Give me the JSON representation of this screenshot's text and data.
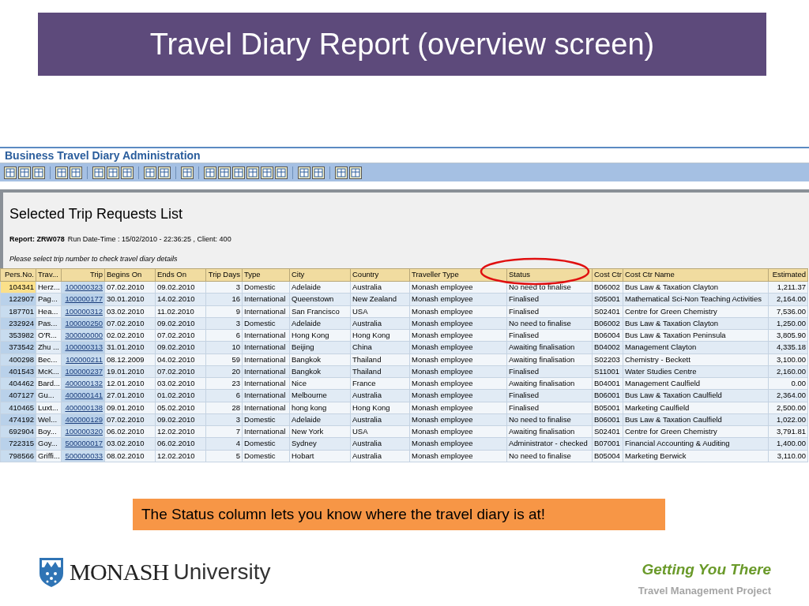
{
  "slide_title": "Travel Diary Report (overview screen)",
  "app": {
    "title": "Business Travel Diary Administration",
    "heading": "Selected Trip Requests List",
    "report_label": "Report: ZRW078",
    "report_info": "Run Date-Time : 15/02/2010 - 22:36:25 , Client: 400",
    "instruction": "Please select trip number to check travel diary details",
    "table": {
      "columns": [
        "Pers.No.",
        "Trav...",
        "Trip",
        "Begins On",
        "Ends On",
        "Trip Days",
        "Type",
        "City",
        "Country",
        "Traveller Type",
        "Status",
        "Cost Ctr",
        "Cost Ctr Name",
        "Estimated"
      ],
      "rows": [
        {
          "selected": true,
          "cells": [
            "104341",
            "Herz...",
            "100000323",
            "07.02.2010",
            "09.02.2010",
            "3",
            "Domestic",
            "Adelaide",
            "Australia",
            "Monash employee",
            "No need to finalise",
            "B06002",
            "Bus Law & Taxation Clayton",
            "1,211.37"
          ]
        },
        {
          "selected": false,
          "cells": [
            "122907",
            "Pag...",
            "100000177",
            "30.01.2010",
            "14.02.2010",
            "16",
            "International",
            "Queenstown",
            "New Zealand",
            "Monash employee",
            "Finalised",
            "S05001",
            "Mathematical Sci-Non Teaching Activities",
            "2,164.00"
          ]
        },
        {
          "selected": false,
          "cells": [
            "187701",
            "Hea...",
            "100000312",
            "03.02.2010",
            "11.02.2010",
            "9",
            "International",
            "San Francisco",
            "USA",
            "Monash employee",
            "Finalised",
            "S02401",
            "Centre for Green Chemistry",
            "7,536.00"
          ]
        },
        {
          "selected": false,
          "cells": [
            "232924",
            "Pas...",
            "100000250",
            "07.02.2010",
            "09.02.2010",
            "3",
            "Domestic",
            "Adelaide",
            "Australia",
            "Monash employee",
            "No need to finalise",
            "B06002",
            "Bus Law & Taxation Clayton",
            "1,250.00"
          ]
        },
        {
          "selected": false,
          "cells": [
            "353982",
            "O'R...",
            "300000000",
            "02.02.2010",
            "07.02.2010",
            "6",
            "International",
            "Hong Kong",
            "Hong Kong",
            "Monash employee",
            "Finalised",
            "B06004",
            "Bus Law & Taxation Peninsula",
            "3,805.90"
          ]
        },
        {
          "selected": false,
          "cells": [
            "373542",
            "Zhu ...",
            "100000313",
            "31.01.2010",
            "09.02.2010",
            "10",
            "International",
            "Beijing",
            "China",
            "Monash employee",
            "Awaiting finalisation",
            "B04002",
            "Management Clayton",
            "4,335.18"
          ]
        },
        {
          "selected": false,
          "cells": [
            "400298",
            "Bec...",
            "100000211",
            "08.12.2009",
            "04.02.2010",
            "59",
            "International",
            "Bangkok",
            "Thailand",
            "Monash employee",
            "Awaiting finalisation",
            "S02203",
            "Chemistry - Beckett",
            "3,100.00"
          ]
        },
        {
          "selected": false,
          "cells": [
            "401543",
            "McK...",
            "100000237",
            "19.01.2010",
            "07.02.2010",
            "20",
            "International",
            "Bangkok",
            "Thailand",
            "Monash employee",
            "Finalised",
            "S11001",
            "Water Studies Centre",
            "2,160.00"
          ]
        },
        {
          "selected": false,
          "cells": [
            "404462",
            "Bard...",
            "400000132",
            "12.01.2010",
            "03.02.2010",
            "23",
            "International",
            "Nice",
            "France",
            "Monash employee",
            "Awaiting finalisation",
            "B04001",
            "Management Caulfield",
            "0.00"
          ]
        },
        {
          "selected": false,
          "cells": [
            "407127",
            "Gu...",
            "400000141",
            "27.01.2010",
            "01.02.2010",
            "6",
            "International",
            "Melbourne",
            "Australia",
            "Monash employee",
            "Finalised",
            "B06001",
            "Bus Law & Taxation Caulfield",
            "2,364.00"
          ]
        },
        {
          "selected": false,
          "cells": [
            "410465",
            "Luxt...",
            "400000138",
            "09.01.2010",
            "05.02.2010",
            "28",
            "International",
            "hong kong",
            "Hong Kong",
            "Monash employee",
            "Finalised",
            "B05001",
            "Marketing Caulfield",
            "2,500.00"
          ]
        },
        {
          "selected": false,
          "cells": [
            "474192",
            "Wel...",
            "400000129",
            "07.02.2010",
            "09.02.2010",
            "3",
            "Domestic",
            "Adelaide",
            "Australia",
            "Monash employee",
            "No need to finalise",
            "B06001",
            "Bus Law & Taxation Caulfield",
            "1,022.00"
          ]
        },
        {
          "selected": false,
          "cells": [
            "692904",
            "Boy...",
            "100000320",
            "06.02.2010",
            "12.02.2010",
            "7",
            "International",
            "New York",
            "USA",
            "Monash employee",
            "Awaiting finalisation",
            "S02401",
            "Centre for Green Chemistry",
            "3,791.81"
          ]
        },
        {
          "selected": false,
          "cells": [
            "722315",
            "Goy...",
            "500000017",
            "03.02.2010",
            "06.02.2010",
            "4",
            "Domestic",
            "Sydney",
            "Australia",
            "Monash employee",
            "Administrator - checked",
            "B07001",
            "Financial Accounting & Auditing",
            "1,400.00"
          ]
        },
        {
          "selected": false,
          "cells": [
            "798566",
            "Griffi...",
            "500000033",
            "08.02.2010",
            "12.02.2010",
            "5",
            "Domestic",
            "Hobart",
            "Australia",
            "Monash employee",
            "No need to finalise",
            "B05004",
            "Marketing Berwick",
            "3,110.00"
          ]
        }
      ]
    }
  },
  "callout": "The Status column lets you know where the travel diary is at!",
  "logo": {
    "name": "MONASH",
    "suffix": "University"
  },
  "footer": {
    "tagline": "Getting You There",
    "project": "Travel Management Project"
  }
}
